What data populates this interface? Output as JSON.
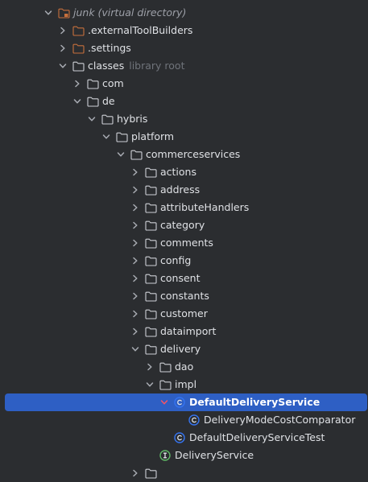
{
  "project_tree": {
    "rows": [
      {
        "label": "junk (virtual directory)",
        "hint": "",
        "depth": 0,
        "expand": "expanded",
        "icon": "module-folder-icon",
        "style": "italic",
        "selected": false
      },
      {
        "label": ".externalToolBuilders",
        "hint": "",
        "depth": 1,
        "expand": "collapsed",
        "icon": "excluded-folder-icon",
        "style": "",
        "selected": false
      },
      {
        "label": ".settings",
        "hint": "",
        "depth": 1,
        "expand": "collapsed",
        "icon": "excluded-folder-icon",
        "style": "",
        "selected": false
      },
      {
        "label": "classes",
        "hint": "library root",
        "depth": 1,
        "expand": "expanded",
        "icon": "folder-icon",
        "style": "",
        "selected": false
      },
      {
        "label": "com",
        "hint": "",
        "depth": 2,
        "expand": "collapsed",
        "icon": "folder-icon",
        "style": "",
        "selected": false
      },
      {
        "label": "de",
        "hint": "",
        "depth": 2,
        "expand": "expanded",
        "icon": "folder-icon",
        "style": "",
        "selected": false
      },
      {
        "label": "hybris",
        "hint": "",
        "depth": 3,
        "expand": "expanded",
        "icon": "folder-icon",
        "style": "",
        "selected": false
      },
      {
        "label": "platform",
        "hint": "",
        "depth": 4,
        "expand": "expanded",
        "icon": "folder-icon",
        "style": "",
        "selected": false
      },
      {
        "label": "commerceservices",
        "hint": "",
        "depth": 5,
        "expand": "expanded",
        "icon": "folder-icon",
        "style": "",
        "selected": false
      },
      {
        "label": "actions",
        "hint": "",
        "depth": 6,
        "expand": "collapsed",
        "icon": "folder-icon",
        "style": "",
        "selected": false
      },
      {
        "label": "address",
        "hint": "",
        "depth": 6,
        "expand": "collapsed",
        "icon": "folder-icon",
        "style": "",
        "selected": false
      },
      {
        "label": "attributeHandlers",
        "hint": "",
        "depth": 6,
        "expand": "collapsed",
        "icon": "folder-icon",
        "style": "",
        "selected": false
      },
      {
        "label": "category",
        "hint": "",
        "depth": 6,
        "expand": "collapsed",
        "icon": "folder-icon",
        "style": "",
        "selected": false
      },
      {
        "label": "comments",
        "hint": "",
        "depth": 6,
        "expand": "collapsed",
        "icon": "folder-icon",
        "style": "",
        "selected": false
      },
      {
        "label": "config",
        "hint": "",
        "depth": 6,
        "expand": "collapsed",
        "icon": "folder-icon",
        "style": "",
        "selected": false
      },
      {
        "label": "consent",
        "hint": "",
        "depth": 6,
        "expand": "collapsed",
        "icon": "folder-icon",
        "style": "",
        "selected": false
      },
      {
        "label": "constants",
        "hint": "",
        "depth": 6,
        "expand": "collapsed",
        "icon": "folder-icon",
        "style": "",
        "selected": false
      },
      {
        "label": "customer",
        "hint": "",
        "depth": 6,
        "expand": "collapsed",
        "icon": "folder-icon",
        "style": "",
        "selected": false
      },
      {
        "label": "dataimport",
        "hint": "",
        "depth": 6,
        "expand": "collapsed",
        "icon": "folder-icon",
        "style": "",
        "selected": false
      },
      {
        "label": "delivery",
        "hint": "",
        "depth": 6,
        "expand": "expanded",
        "icon": "folder-icon",
        "style": "",
        "selected": false
      },
      {
        "label": "dao",
        "hint": "",
        "depth": 7,
        "expand": "collapsed",
        "icon": "folder-icon",
        "style": "",
        "selected": false
      },
      {
        "label": "impl",
        "hint": "",
        "depth": 7,
        "expand": "expanded",
        "icon": "folder-icon",
        "style": "",
        "selected": false
      },
      {
        "label": "DefaultDeliveryService",
        "hint": "",
        "depth": 8,
        "expand": "expanded",
        "icon": "class-icon",
        "style": "bold",
        "selected": true
      },
      {
        "label": "DeliveryModeCostComparator",
        "hint": "",
        "depth": 9,
        "expand": "none",
        "icon": "class-icon",
        "style": "",
        "selected": false
      },
      {
        "label": "DefaultDeliveryServiceTest",
        "hint": "",
        "depth": 8,
        "expand": "none",
        "icon": "class-icon",
        "style": "",
        "selected": false
      },
      {
        "label": "DeliveryService",
        "hint": "",
        "depth": 7,
        "expand": "none",
        "icon": "interface-icon",
        "style": "",
        "selected": false
      },
      {
        "label": "",
        "hint": "",
        "depth": 6,
        "expand": "collapsed",
        "icon": "folder-icon",
        "style": "",
        "selected": false
      }
    ]
  },
  "colors": {
    "background": "#2b2d30",
    "selection": "#2e5fc4",
    "text": "#dfe1e5",
    "hint_text": "#6f737a",
    "folder_stroke": "#ced0d6",
    "excluded_folder_stroke": "#c8703c",
    "class_icon": "#3574f0",
    "interface_icon": "#5fb865",
    "chevron": "#a8abb2",
    "chevron_selected": "#f75464"
  }
}
